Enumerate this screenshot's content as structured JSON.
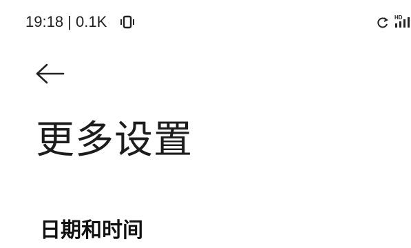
{
  "status_bar": {
    "time_and_speed": "19:18 | 0.1K",
    "vibrate_icon": "vibrate-icon",
    "sync_icon": "sync-icon",
    "signal_icon": "hd-signal-icon",
    "signal_badge": "HD"
  },
  "header": {
    "back_icon": "arrow-left-icon",
    "title": "更多设置"
  },
  "list": {
    "items": [
      {
        "label": "日期和时间"
      }
    ]
  }
}
